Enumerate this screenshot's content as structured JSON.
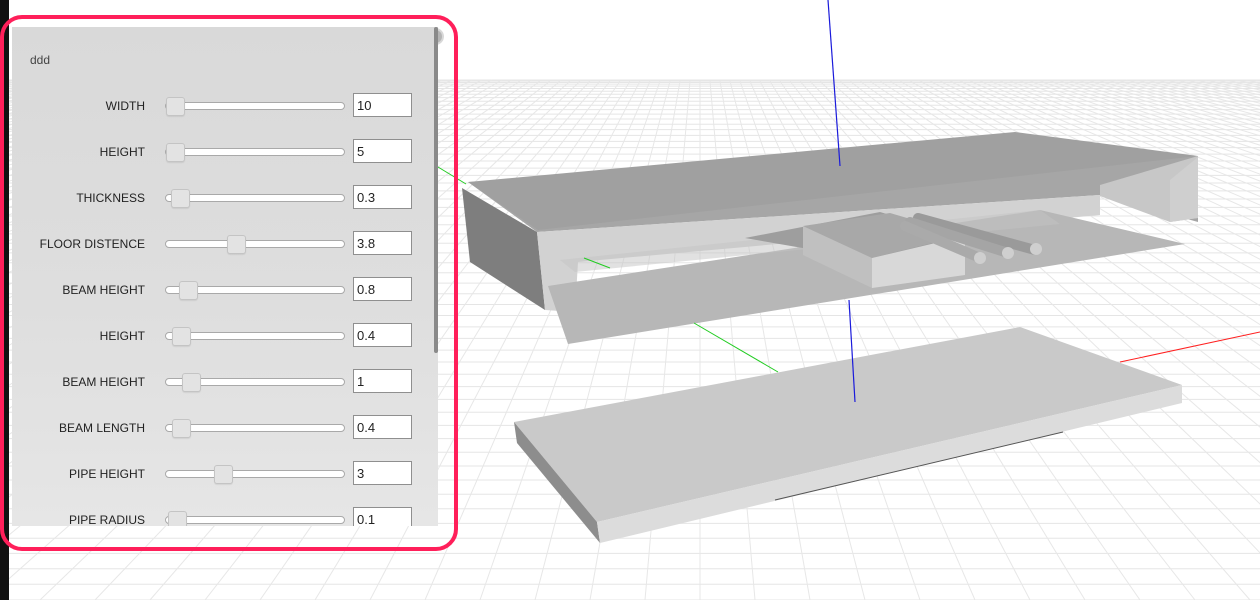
{
  "panel": {
    "title": "ddd",
    "accent_color": "#ff1f5a",
    "controls": [
      {
        "label": "WIDTH",
        "value": "10",
        "slider_fraction": 0.0
      },
      {
        "label": "HEIGHT",
        "value": "5",
        "slider_fraction": 0.0
      },
      {
        "label": "THICKNESS",
        "value": "0.3",
        "slider_fraction": 0.03
      },
      {
        "label": "FLOOR DISTENCE",
        "value": "3.8",
        "slider_fraction": 0.38
      },
      {
        "label": "BEAM HEIGHT",
        "value": "0.8",
        "slider_fraction": 0.08
      },
      {
        "label": "HEIGHT",
        "value": "0.4",
        "slider_fraction": 0.04
      },
      {
        "label": "BEAM HEIGHT",
        "value": "1",
        "slider_fraction": 0.1
      },
      {
        "label": "BEAM LENGTH",
        "value": "0.4",
        "slider_fraction": 0.04
      },
      {
        "label": "PIPE HEIGHT",
        "value": "3",
        "slider_fraction": 0.3
      },
      {
        "label": "PIPE RADIUS",
        "value": "0.1",
        "slider_fraction": 0.01
      }
    ]
  },
  "scene": {
    "axis_x_color": "#ff2020",
    "axis_y_color": "#1a1adb",
    "axis_z_color": "#22cc22"
  }
}
